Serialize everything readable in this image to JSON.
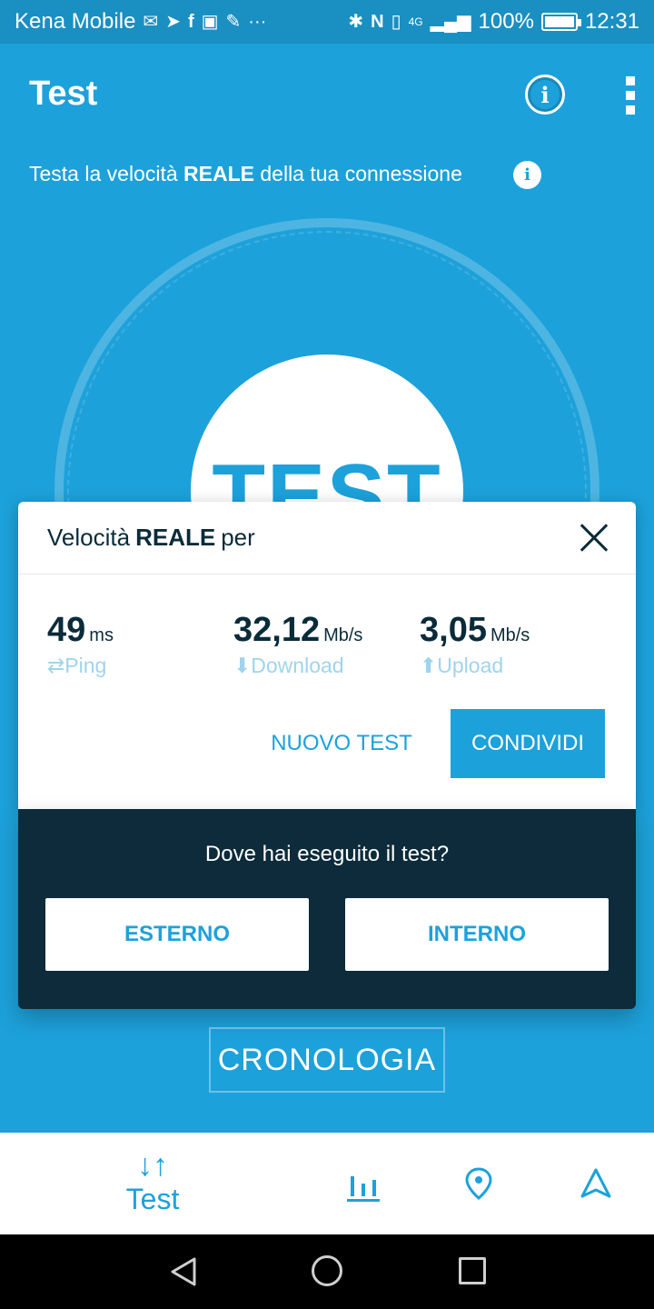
{
  "status_bar": {
    "carrier": "Kena Mobile",
    "left_icons": [
      "mail-icon",
      "send-icon",
      "facebook-icon",
      "photo-icon",
      "wrench-icon",
      "more-icon"
    ],
    "right_icons": [
      "bluetooth-icon",
      "nfc-icon",
      "vibrate-icon",
      "signal-4g-icon"
    ],
    "network_label": "4G",
    "battery": "100%",
    "time": "12:31"
  },
  "app_bar": {
    "title": "Test",
    "info_glyph": "i"
  },
  "subtitle": {
    "before": "Testa la velocità ",
    "bold": "REALE",
    "after": " della tua connessione",
    "info_glyph": "i"
  },
  "gauge": {
    "button_label": "TEST"
  },
  "result_card": {
    "title_before": "Velocità",
    "title_bold": "REALE",
    "title_after": "per",
    "metrics": [
      {
        "value": "49",
        "unit": "ms",
        "label": "Ping",
        "icon": "swap-arrows-icon",
        "glyph": "⇄"
      },
      {
        "value": "32,12",
        "unit": "Mb/s",
        "label": "Download",
        "icon": "download-arrow-icon",
        "glyph": "⬇"
      },
      {
        "value": "3,05",
        "unit": "Mb/s",
        "label": "Upload",
        "icon": "upload-arrow-icon",
        "glyph": "⬆"
      }
    ],
    "new_test_label": "NUOVO TEST",
    "share_label": "CONDIVIDI"
  },
  "where_panel": {
    "question": "Dove hai eseguito il test?",
    "outdoor_label": "ESTERNO",
    "indoor_label": "INTERNO"
  },
  "history_label": "CRONOLOGIA",
  "bottom_nav": {
    "test_label": "Test",
    "test_glyph": "↓↑",
    "items": [
      "speed-test-icon",
      "stats-icon",
      "map-pin-icon",
      "share-arrow-icon"
    ]
  },
  "colors": {
    "primary": "#1da1da",
    "status_bar": "#1a8fc2",
    "dark_panel": "#0d2b3a",
    "text_dark": "#0a2b3a",
    "label_light": "#9fd4ec"
  }
}
